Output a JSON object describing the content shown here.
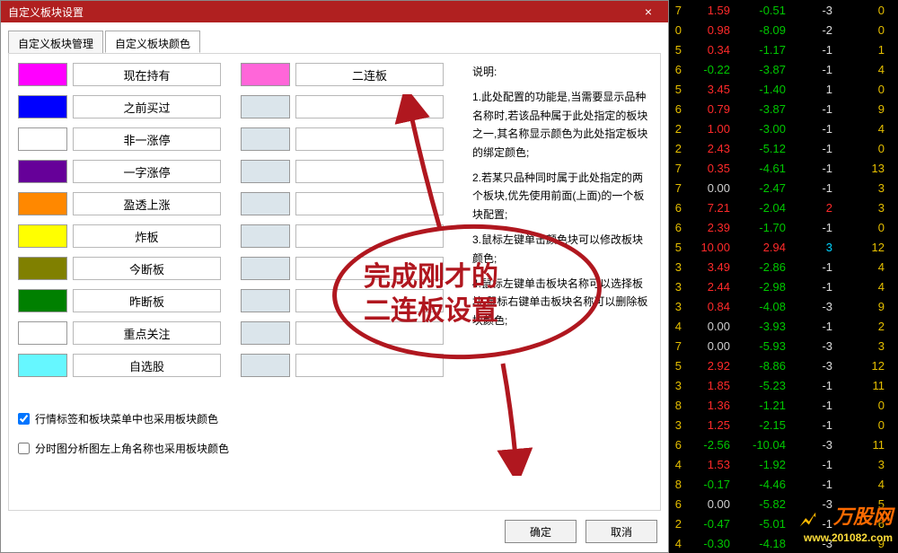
{
  "window": {
    "title": "自定义板块设置",
    "close_label": "×"
  },
  "tabs": [
    {
      "label": "自定义板块管理",
      "active": false
    },
    {
      "label": "自定义板块颜色",
      "active": true
    }
  ],
  "colA": [
    {
      "color": "#ff00ff",
      "label": "现在持有"
    },
    {
      "color": "#0000ff",
      "label": "之前买过"
    },
    {
      "color": "#ffffff",
      "label": "非一涨停"
    },
    {
      "color": "#660099",
      "label": "一字涨停"
    },
    {
      "color": "#ff8800",
      "label": "盈透上涨"
    },
    {
      "color": "#ffff00",
      "label": "炸板"
    },
    {
      "color": "#808000",
      "label": "今断板"
    },
    {
      "color": "#008000",
      "label": "昨断板"
    },
    {
      "color": "#ffffff",
      "label": "重点关注"
    },
    {
      "color": "#66f7ff",
      "label": "自选股"
    }
  ],
  "colB": [
    {
      "color": "#ff66d9",
      "label": "二连板"
    }
  ],
  "checks": {
    "c1": "行情标签和板块菜单中也采用板块颜色",
    "c2": "分时图分析图左上角名称也采用板块颜色"
  },
  "desc": {
    "title": "说明:",
    "p1": "1.此处配置的功能是,当需要显示品种名称时,若该品种属于此处指定的板块之一,其名称显示颜色为此处指定板块的绑定颜色;",
    "p2": "2.若某只品种同时属于此处指定的两个板块,优先使用前面(上面)的一个板块配置;",
    "p3a": "3.鼠标左键单击颜色块可以修改板块颜色;",
    "p4a": "4.鼠标左键单击板块名称可以选择板块,鼠标右键单击板块名称可以删除板块颜色;"
  },
  "buttons": {
    "ok": "确定",
    "cancel": "取消"
  },
  "annotation": {
    "line1": "完成刚才的",
    "line2": "二连板设置"
  },
  "watermark": {
    "text": "万股网",
    "sub": "www.201082.com"
  },
  "stock_rows": [
    {
      "c0": "7",
      "c1": "1.59",
      "c1c": "pos",
      "c2": "-0.51",
      "c2c": "neg",
      "c3": "-3",
      "c4": "0"
    },
    {
      "c0": "0",
      "c1": "0.98",
      "c1c": "pos",
      "c2": "-8.09",
      "c2c": "neg",
      "c3": "-2",
      "c4": "0"
    },
    {
      "c0": "5",
      "c1": "0.34",
      "c1c": "pos",
      "c2": "-1.17",
      "c2c": "neg",
      "c3": "-1",
      "c4": "1"
    },
    {
      "c0": "6",
      "c1": "-0.22",
      "c1c": "neg",
      "c2": "-3.87",
      "c2c": "neg",
      "c3": "-1",
      "c4": "4"
    },
    {
      "c0": "5",
      "c1": "3.45",
      "c1c": "pos",
      "c2": "-1.40",
      "c2c": "neg",
      "c3": "1",
      "c4": "0"
    },
    {
      "c0": "6",
      "c1": "0.79",
      "c1c": "pos",
      "c2": "-3.87",
      "c2c": "neg",
      "c3": "-1",
      "c4": "9"
    },
    {
      "c0": "2",
      "c1": "1.00",
      "c1c": "pos",
      "c2": "-3.00",
      "c2c": "neg",
      "c3": "-1",
      "c4": "4"
    },
    {
      "c0": "2",
      "c1": "2.43",
      "c1c": "pos",
      "c2": "-5.12",
      "c2c": "neg",
      "c3": "-1",
      "c4": "0"
    },
    {
      "c0": "7",
      "c1": "0.35",
      "c1c": "pos",
      "c2": "-4.61",
      "c2c": "neg",
      "c3": "-1",
      "c4": "13"
    },
    {
      "c0": "7",
      "c1": "0.00",
      "c1c": "neu",
      "c2": "-2.47",
      "c2c": "neg",
      "c3": "-1",
      "c4": "3"
    },
    {
      "c0": "6",
      "c1": "7.21",
      "c1c": "pos",
      "c2": "-2.04",
      "c2c": "neg",
      "c3": "2",
      "c3c": "pos",
      "c4": "3"
    },
    {
      "c0": "6",
      "c1": "2.39",
      "c1c": "pos",
      "c2": "-1.70",
      "c2c": "neg",
      "c3": "-1",
      "c4": "0"
    },
    {
      "c0": "5",
      "c1": "10.00",
      "c1c": "pos",
      "c2": "2.94",
      "c2c": "pos",
      "c3": "3",
      "c3c": "hl",
      "c4": "12"
    },
    {
      "c0": "3",
      "c1": "3.49",
      "c1c": "pos",
      "c2": "-2.86",
      "c2c": "neg",
      "c3": "-1",
      "c4": "4"
    },
    {
      "c0": "3",
      "c1": "2.44",
      "c1c": "pos",
      "c2": "-2.98",
      "c2c": "neg",
      "c3": "-1",
      "c4": "4"
    },
    {
      "c0": "3",
      "c1": "0.84",
      "c1c": "pos",
      "c2": "-4.08",
      "c2c": "neg",
      "c3": "-3",
      "c4": "9"
    },
    {
      "c0": "4",
      "c1": "0.00",
      "c1c": "neu",
      "c2": "-3.93",
      "c2c": "neg",
      "c3": "-1",
      "c4": "2"
    },
    {
      "c0": "7",
      "c1": "0.00",
      "c1c": "neu",
      "c2": "-5.93",
      "c2c": "neg",
      "c3": "-3",
      "c4": "3"
    },
    {
      "c0": "5",
      "c1": "2.92",
      "c1c": "pos",
      "c2": "-8.86",
      "c2c": "neg",
      "c3": "-3",
      "c4": "12"
    },
    {
      "c0": "3",
      "c1": "1.85",
      "c1c": "pos",
      "c2": "-5.23",
      "c2c": "neg",
      "c3": "-1",
      "c4": "11"
    },
    {
      "c0": "8",
      "c1": "1.36",
      "c1c": "pos",
      "c2": "-1.21",
      "c2c": "neg",
      "c3": "-1",
      "c4": "0"
    },
    {
      "c0": "3",
      "c1": "1.25",
      "c1c": "pos",
      "c2": "-2.15",
      "c2c": "neg",
      "c3": "-1",
      "c4": "0"
    },
    {
      "c0": "6",
      "c1": "-2.56",
      "c1c": "neg",
      "c2": "-10.04",
      "c2c": "neg",
      "c3": "-3",
      "c4": "11"
    },
    {
      "c0": "4",
      "c1": "1.53",
      "c1c": "pos",
      "c2": "-1.92",
      "c2c": "neg",
      "c3": "-1",
      "c4": "3"
    },
    {
      "c0": "8",
      "c1": "-0.17",
      "c1c": "neg",
      "c2": "-4.46",
      "c2c": "neg",
      "c3": "-1",
      "c4": "4"
    },
    {
      "c0": "6",
      "c1": "0.00",
      "c1c": "neu",
      "c2": "-5.82",
      "c2c": "neg",
      "c3": "-3",
      "c4": "5"
    },
    {
      "c0": "2",
      "c1": "-0.47",
      "c1c": "neg",
      "c2": "-5.01",
      "c2c": "neg",
      "c3": "-1",
      "c4": "6"
    },
    {
      "c0": "4",
      "c1": "-0.30",
      "c1c": "neg",
      "c2": "-4.18",
      "c2c": "neg",
      "c3": "-3",
      "c4": "9"
    }
  ]
}
